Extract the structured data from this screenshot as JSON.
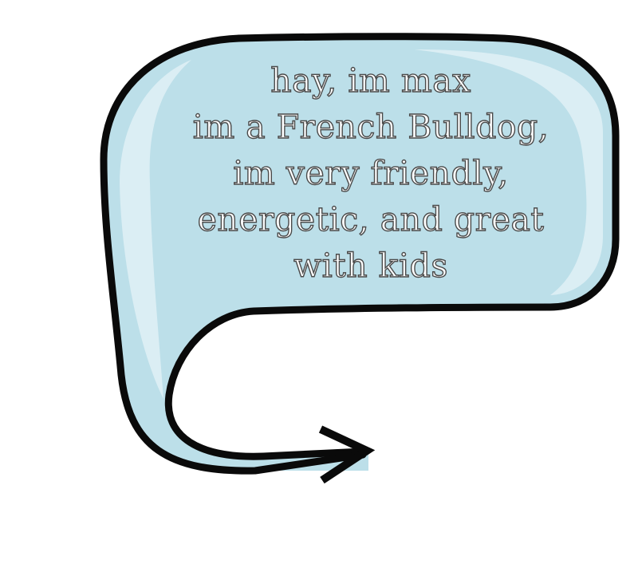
{
  "speech_bubble": {
    "lines": [
      "hay, im max",
      "im a French Bulldog,",
      "im very friendly,",
      "energetic, and great",
      "with kids"
    ]
  },
  "colors": {
    "bubble_fill": "#bcdfe9",
    "bubble_highlight": "#dbeef4",
    "outline": "#0a0a0a",
    "text_stroke": "#4a4a4a"
  },
  "icons": {
    "tail": "curved-arrow-icon"
  }
}
